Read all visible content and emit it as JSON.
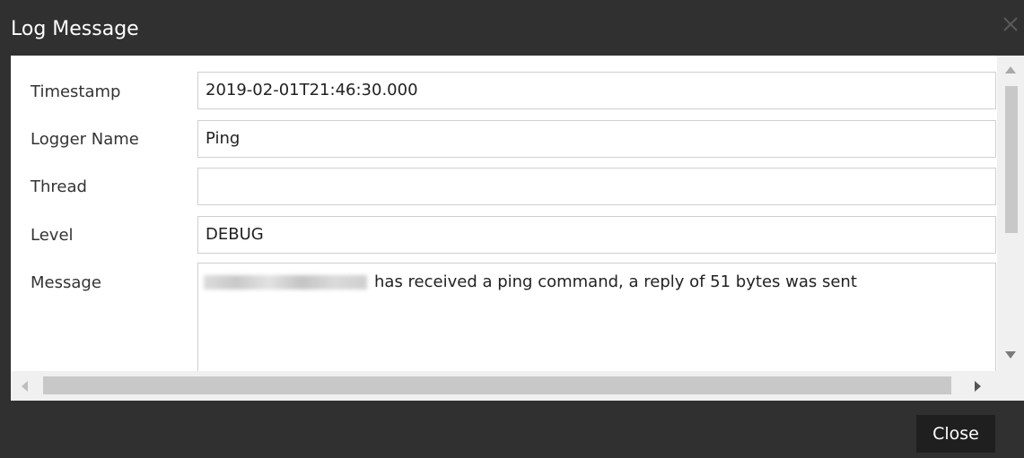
{
  "dialog": {
    "title": "Log Message",
    "close_button_label": "Close"
  },
  "fields": [
    {
      "label": "Timestamp",
      "value": "2019-02-01T21:46:30.000"
    },
    {
      "label": "Logger Name",
      "value": "Ping"
    },
    {
      "label": "Thread",
      "value": ""
    },
    {
      "label": "Level",
      "value": "DEBUG"
    },
    {
      "label": "Message",
      "value": "has received a ping command, a reply of 51 bytes was sent"
    }
  ],
  "icons": {
    "close": "close-icon",
    "scroll_up": "scroll-up-arrow-icon",
    "scroll_down": "scroll-down-arrow-icon",
    "scroll_left": "scroll-left-arrow-icon",
    "scroll_right": "scroll-right-arrow-icon"
  },
  "colors": {
    "title_bar": "#303030",
    "content_bg": "#ffffff",
    "button_bg": "#1f1f1f"
  }
}
